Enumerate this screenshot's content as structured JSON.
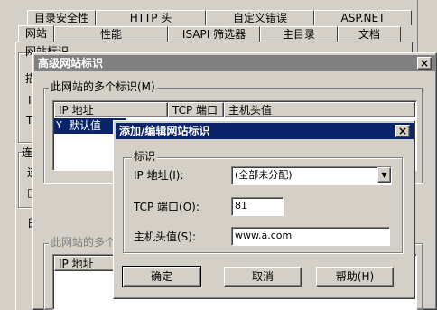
{
  "tabs_row1": [
    "目录安全性",
    "HTTP 头",
    "自定义错误",
    "ASP.NET"
  ],
  "tabs_row2": [
    "网站",
    "性能",
    "ISAPI 筛选器",
    "主目录",
    "文档"
  ],
  "bg": {
    "group_partial": "网站标识",
    "lbl_a": "描",
    "lbl_b": "I",
    "lbl_c": "T",
    "conn_partial": "连",
    "lbl_d": "连",
    "lbl_e": "日",
    "lbl_f": "□"
  },
  "adv_dialog": {
    "title": "高级网站标识",
    "close": "×",
    "group1": "此网站的多个标识(M)",
    "columns": [
      "IP 地址",
      "TCP 端口",
      "主机头值"
    ],
    "selected_row": "默认值",
    "group2": "此网站的多个",
    "columns2": [
      "IP 地址"
    ]
  },
  "edit_dialog": {
    "title": "添加/编辑网站标识",
    "close": "×",
    "group": "标识",
    "ip_label": "IP 地址(I):",
    "ip_value": "(全部未分配)",
    "port_label": "TCP 端口(O):",
    "port_value": "81",
    "host_label": "主机头值(S):",
    "host_value": "www.a.com",
    "ok": "确定",
    "cancel": "取消",
    "help": "帮助(H)"
  },
  "colors": {
    "active_title": "#0a246a",
    "inactive_title": "#808080",
    "face": "#d4d0c8"
  }
}
